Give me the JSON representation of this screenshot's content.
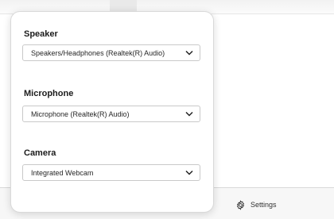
{
  "app": {
    "settings_label": "Settings"
  },
  "panel": {
    "speaker": {
      "title": "Speaker",
      "value": "Speakers/Headphones (Realtek(R) Audio)"
    },
    "microphone": {
      "title": "Microphone",
      "value": "Microphone (Realtek(R) Audio)"
    },
    "camera": {
      "title": "Camera",
      "value": "Integrated Webcam"
    }
  },
  "icons": {
    "dropdown": "chevron-down-icon",
    "settings": "gear-icon"
  },
  "colors": {
    "panel_bg": "#ffffff",
    "border": "#c9c9c9",
    "bottom_bar": "#f7f7f7"
  }
}
